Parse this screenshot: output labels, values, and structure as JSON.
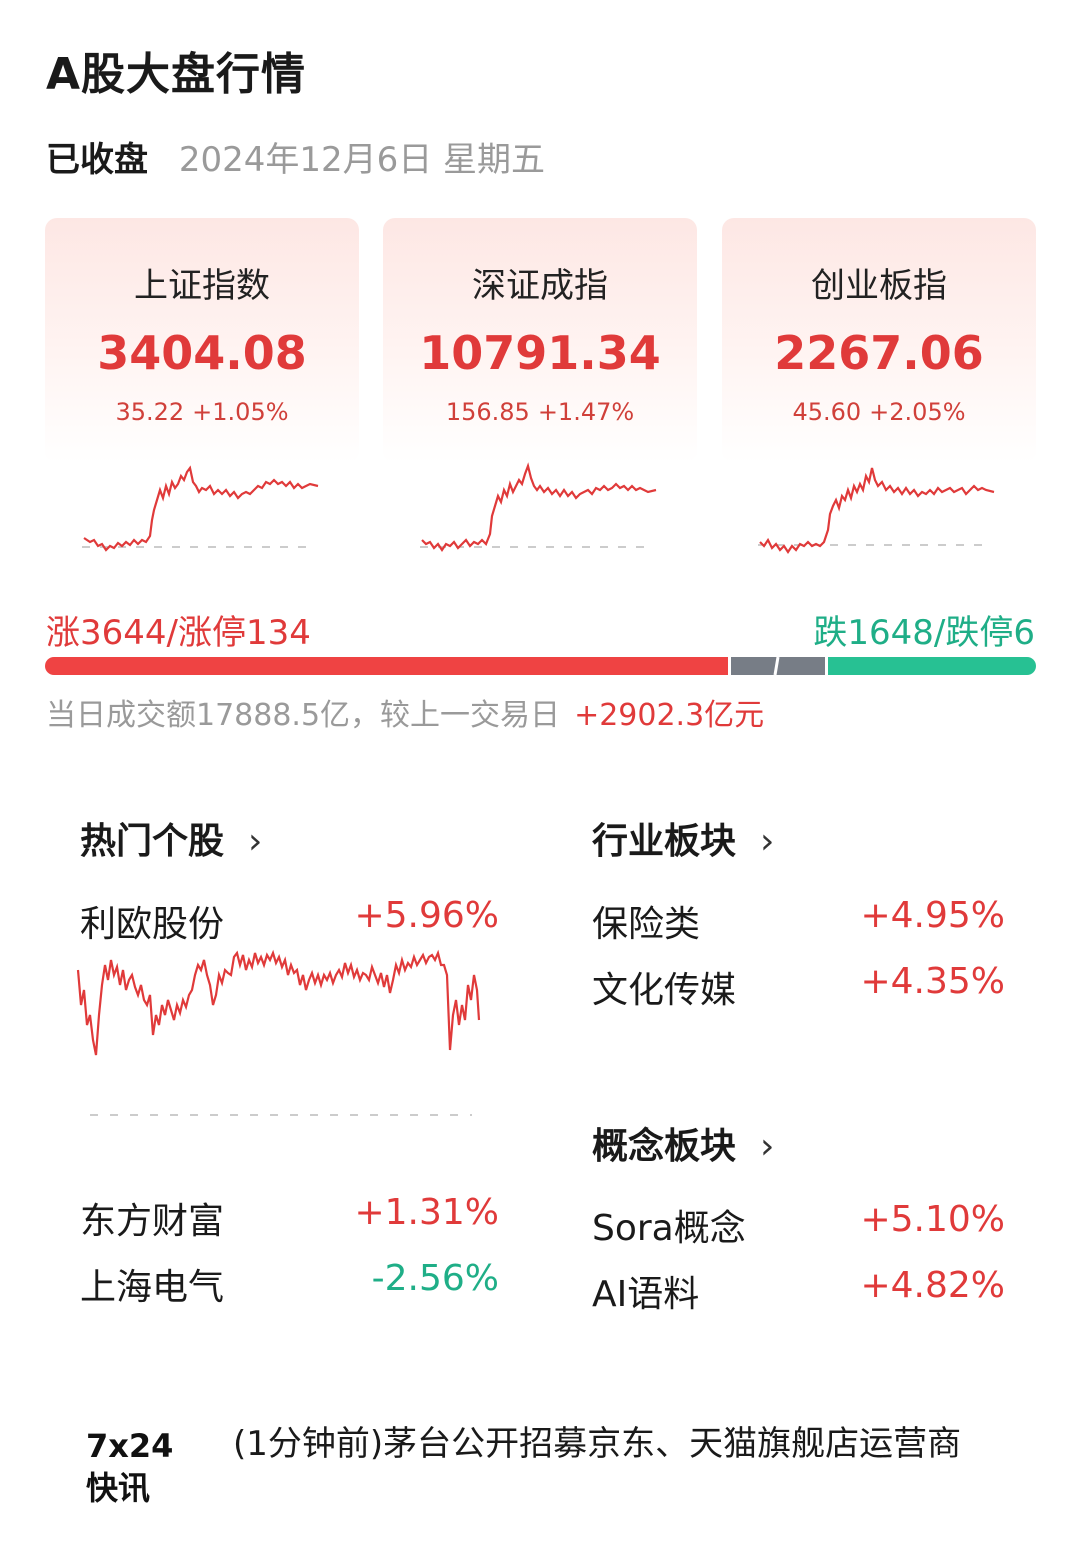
{
  "page": {
    "title": "A股大盘行情"
  },
  "status": {
    "state": "已收盘",
    "date": "2024年12月6日 星期五"
  },
  "indices": [
    {
      "name": "上证指数",
      "price": "3404.08",
      "change": "35.22",
      "pct": "+1.05%"
    },
    {
      "name": "深证成指",
      "price": "10791.34",
      "change": "156.85",
      "pct": "+1.47%"
    },
    {
      "name": "创业板指",
      "price": "2267.06",
      "change": "45.60",
      "pct": "+2.05%"
    }
  ],
  "breadth": {
    "up_text": "涨3644/涨停134",
    "down_text": "跌1648/跌停6",
    "up_count": 3644,
    "down_count": 1648
  },
  "turnover": {
    "text": "当日成交额17888.5亿，较上一交易日",
    "delta": "+2902.3亿元"
  },
  "hot_stocks": {
    "title": "热门个股",
    "chevron": "›",
    "items": [
      {
        "name": "利欧股份",
        "pct": "+5.96%",
        "direction": "up"
      },
      {
        "name": "东方财富",
        "pct": "+1.31%",
        "direction": "up"
      },
      {
        "name": "上海电气",
        "pct": "-2.56%",
        "direction": "down"
      }
    ]
  },
  "industry": {
    "title": "行业板块",
    "chevron": "›",
    "items": [
      {
        "name": "保险类",
        "pct": "+4.95%"
      },
      {
        "name": "文化传媒",
        "pct": "+4.35%"
      }
    ]
  },
  "concept": {
    "title": "概念板块",
    "chevron": "›",
    "items": [
      {
        "name": "Sora概念",
        "pct": "+5.10%"
      },
      {
        "name": "AI语料",
        "pct": "+4.82%"
      }
    ]
  },
  "news": {
    "logo_top": "7x24",
    "logo_bottom": "快讯",
    "text": "(1分钟前)茅台公开招募京东、天猫旗舰店运营商"
  },
  "colors": {
    "up": "#e03a3a",
    "down": "#1fae87",
    "flat": "#777d86",
    "muted": "#9a9a9a"
  }
}
